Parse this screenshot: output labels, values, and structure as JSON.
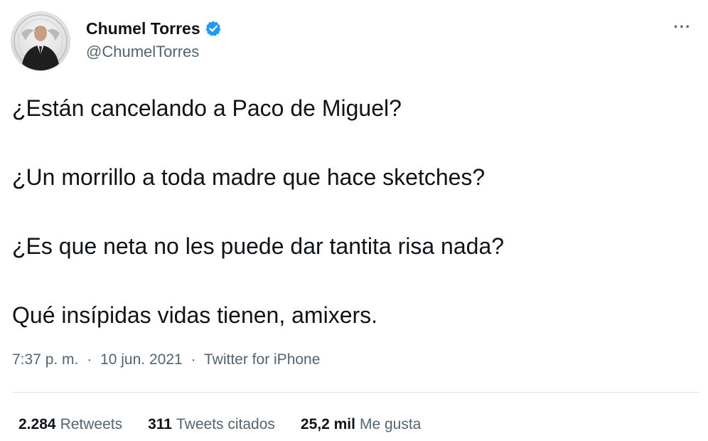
{
  "author": {
    "display_name": "Chumel Torres",
    "handle": "@ChumelTorres",
    "verified": true,
    "verified_color": "#1d9bf0"
  },
  "menu": {
    "icon": "more-horizontal-icon",
    "glyph": "···"
  },
  "tweet": {
    "lines": [
      "¿Están cancelando a Paco de Miguel?",
      "¿Un morrillo a toda madre que hace sketches?",
      "¿Es que neta no les puede dar tantita risa nada?",
      "Qué insípidas vidas tienen, amixers."
    ]
  },
  "meta": {
    "time": "7:37 p. m.",
    "separator": "·",
    "date": "10 jun. 2021",
    "source": "Twitter for iPhone"
  },
  "stats": {
    "retweets_count": "2.284",
    "retweets_label": "Retweets",
    "quotes_count": "311",
    "quotes_label": "Tweets citados",
    "likes_count": "25,2 mil",
    "likes_label": "Me gusta"
  },
  "colors": {
    "text_primary": "#0f1419",
    "text_secondary": "#536471",
    "divider": "#dfe3e6"
  }
}
